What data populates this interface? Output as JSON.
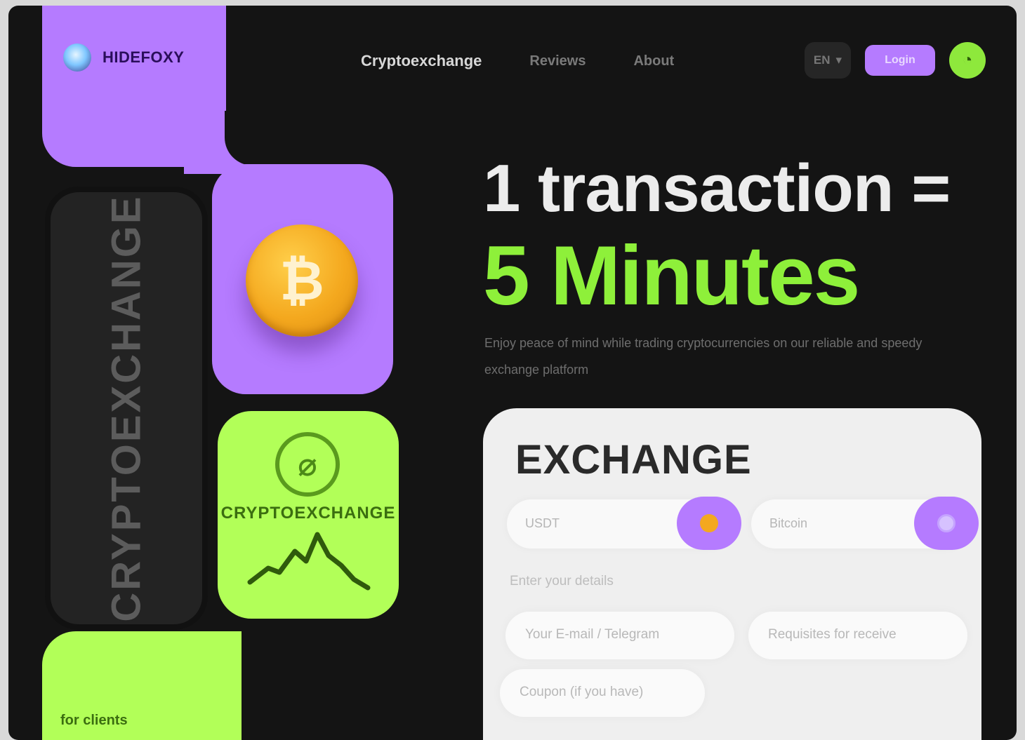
{
  "header": {
    "logo_text": "HIDEFOXY",
    "nav": [
      "Cryptoexchange",
      "Reviews",
      "About"
    ],
    "lang": "EN",
    "login_label": "Login",
    "profile_icon": "user-icon"
  },
  "hero": {
    "line1": "1 transaction =",
    "line2": "5 Minutes",
    "description": "Enjoy peace of mind while trading cryptocurrencies on our reliable and speedy exchange platform"
  },
  "side": {
    "vertical_text": "CRYPTOEXCHANGE",
    "coin_symbol": "₿",
    "green_logo_symbol": "⌀",
    "green_label": "CRYPTOEXCHANGE",
    "bottom_text": "for clients"
  },
  "exchange": {
    "title": "EXCHANGE",
    "from_placeholder": "USDT",
    "to_placeholder": "Bitcoin",
    "enter_label": "Enter your details",
    "fields": [
      "Your E-mail / Telegram",
      "Requisites for receive",
      "Coupon (if you have)"
    ]
  },
  "colors": {
    "background": "#141414",
    "purple": "#b57bff",
    "green": "#b2ff58",
    "accent_green": "#8ef03a",
    "card": "#efefef"
  }
}
